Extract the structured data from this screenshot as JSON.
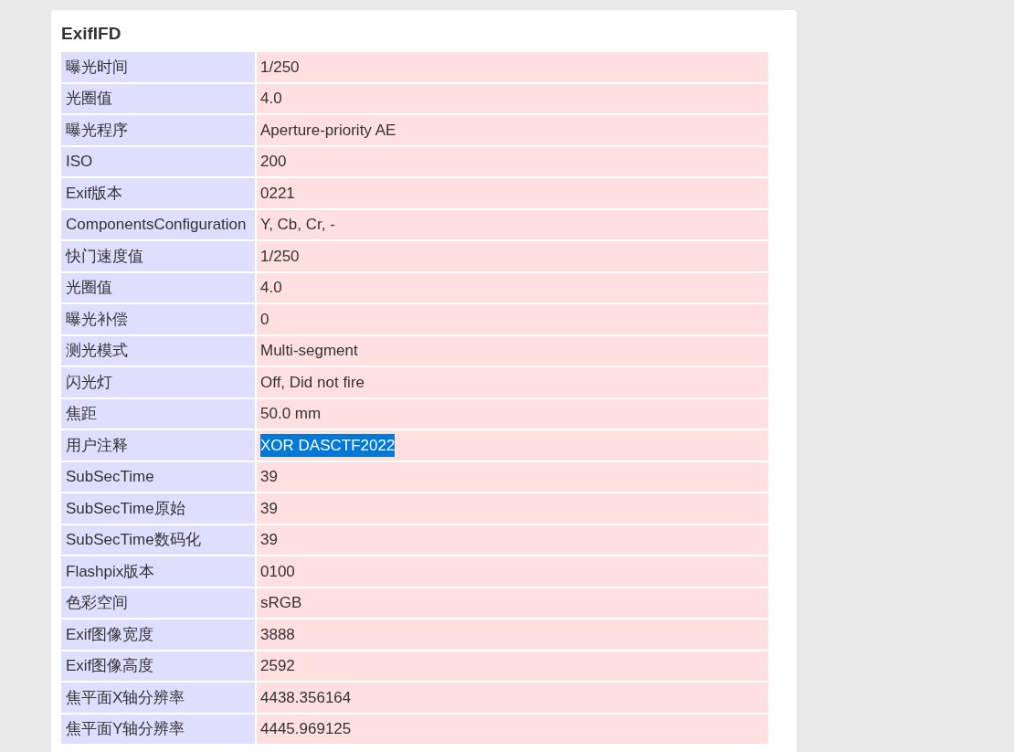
{
  "section": {
    "title": "ExifIFD"
  },
  "rows": [
    {
      "label": "曝光时间",
      "value": "1/250",
      "selected": false
    },
    {
      "label": "光圈值",
      "value": "4.0",
      "selected": false
    },
    {
      "label": "曝光程序",
      "value": "Aperture-priority AE",
      "selected": false
    },
    {
      "label": "ISO",
      "value": "200",
      "selected": false
    },
    {
      "label": "Exif版本",
      "value": "0221",
      "selected": false
    },
    {
      "label": "ComponentsConfiguration",
      "value": "Y, Cb, Cr, -",
      "selected": false
    },
    {
      "label": "快门速度值",
      "value": "1/250",
      "selected": false
    },
    {
      "label": "光圈值",
      "value": "4.0",
      "selected": false
    },
    {
      "label": "曝光补偿",
      "value": "0",
      "selected": false
    },
    {
      "label": "测光模式",
      "value": "Multi-segment",
      "selected": false
    },
    {
      "label": "闪光灯",
      "value": "Off, Did not fire",
      "selected": false
    },
    {
      "label": "焦距",
      "value": "50.0 mm",
      "selected": false
    },
    {
      "label": "用户注释",
      "value": "XOR DASCTF2022",
      "selected": true
    },
    {
      "label": "SubSecTime",
      "value": "39",
      "selected": false
    },
    {
      "label": "SubSecTime原始",
      "value": "39",
      "selected": false
    },
    {
      "label": "SubSecTime数码化",
      "value": "39",
      "selected": false
    },
    {
      "label": "Flashpix版本",
      "value": "0100",
      "selected": false
    },
    {
      "label": "色彩空间",
      "value": "sRGB",
      "selected": false
    },
    {
      "label": "Exif图像宽度",
      "value": "3888",
      "selected": false
    },
    {
      "label": "Exif图像高度",
      "value": "2592",
      "selected": false
    },
    {
      "label": "焦平面X轴分辨率",
      "value": "4438.356164",
      "selected": false
    },
    {
      "label": "焦平面Y轴分辨率",
      "value": "4445.969125",
      "selected": false
    }
  ]
}
